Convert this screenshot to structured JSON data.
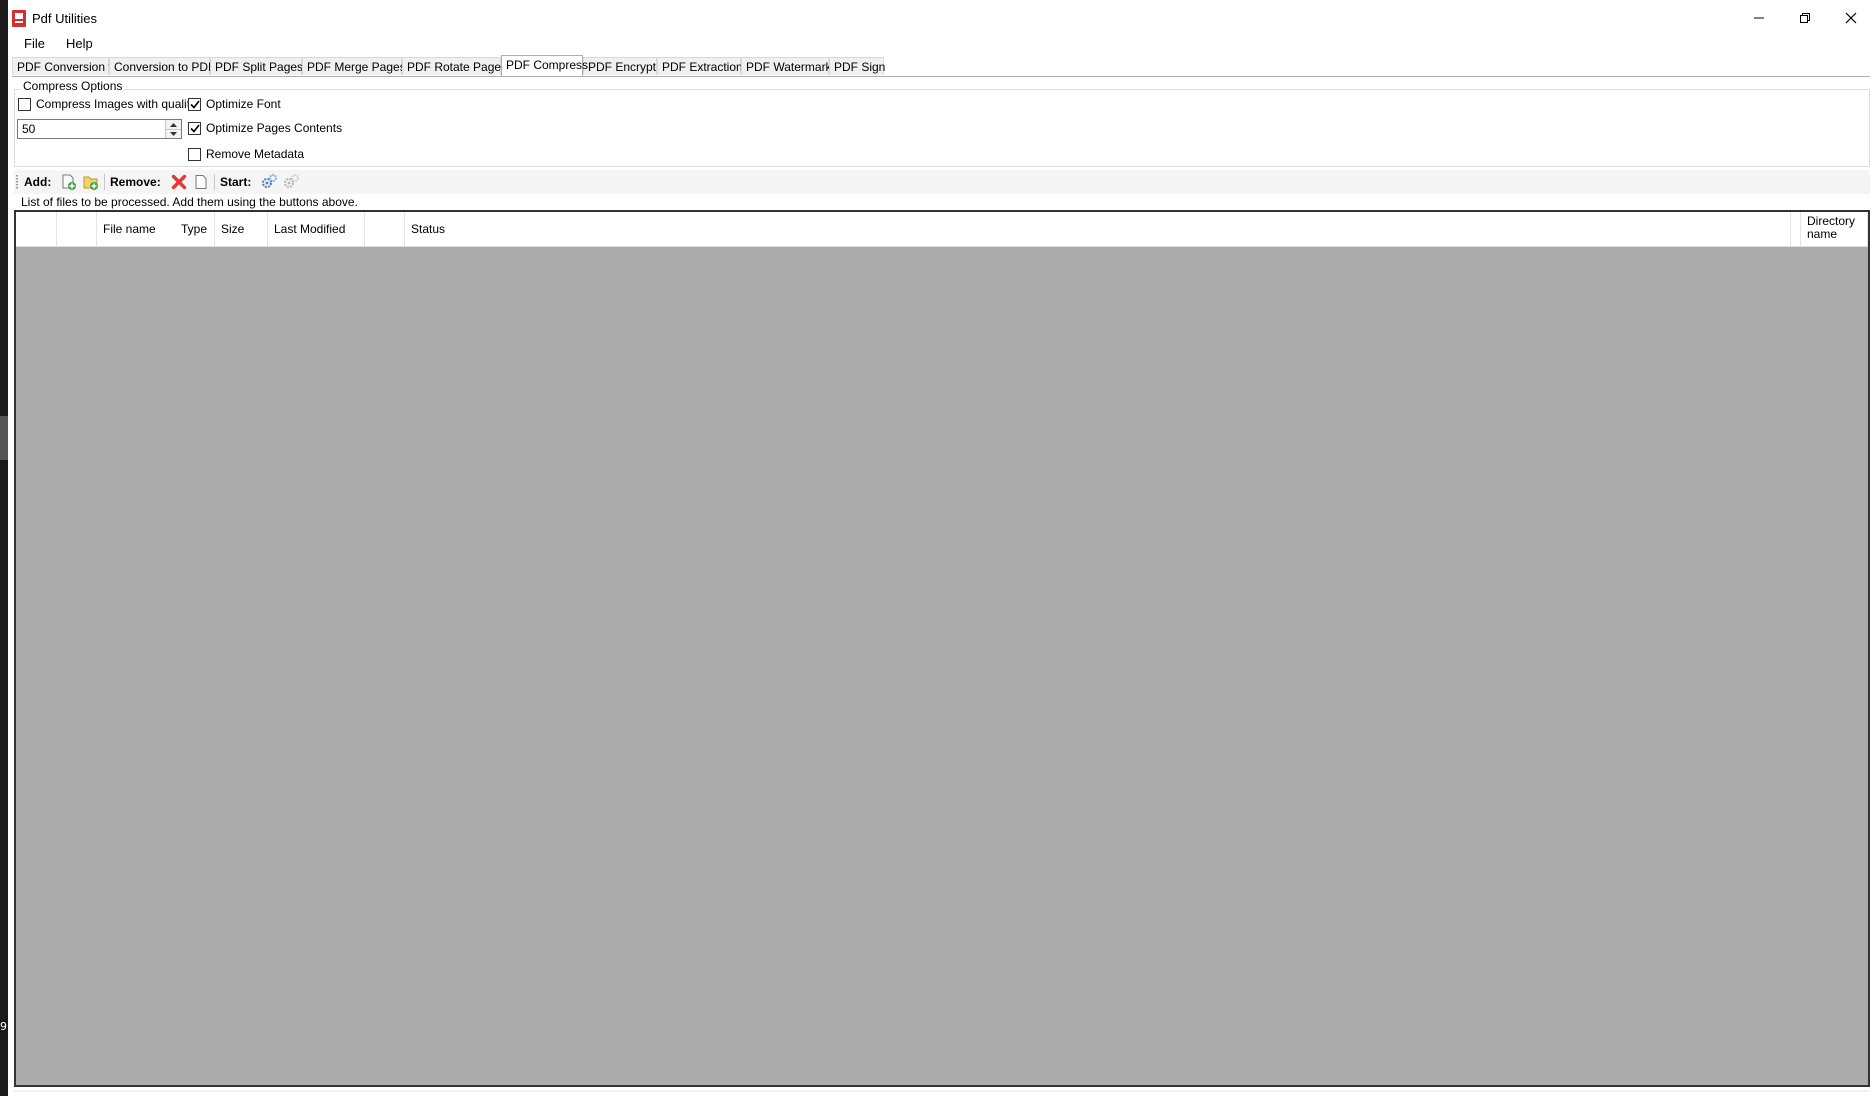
{
  "window": {
    "title": "Pdf Utilities",
    "controls": {
      "minimize": "minimize-icon",
      "restore": "restore-icon",
      "close": "close-icon"
    }
  },
  "left_strip": {
    "digit": "9"
  },
  "menu": {
    "items": [
      "File",
      "Help"
    ]
  },
  "tabs": [
    "PDF Conversion to",
    "Conversion to PDF",
    "PDF Split Pages",
    "PDF Merge Pages",
    "PDF Rotate Pages",
    "PDF Compress",
    "PDF Encrypt",
    "PDF Extraction",
    "PDF Watermark",
    "PDF Sign"
  ],
  "active_tab": "PDF Compress",
  "compress_options": {
    "title": "Compress Options",
    "compress_images": {
      "label": "Compress Images with quality",
      "checked": false
    },
    "quality_value": "50",
    "optimize_font": {
      "label": "Optimize Font",
      "checked": true
    },
    "optimize_pages": {
      "label": "Optimize Pages Contents",
      "checked": true
    },
    "remove_metadata": {
      "label": "Remove Metadata",
      "checked": false
    }
  },
  "toolbar": {
    "add_label": "Add:",
    "remove_label": "Remove:",
    "start_label": "Start:"
  },
  "hint": "List of files to be processed. Add  them using the buttons above.",
  "file_list": {
    "columns": [
      "",
      "",
      "File name",
      "Type",
      "Size",
      "Last Modified",
      "",
      "Status",
      "",
      "Directory name"
    ],
    "rows": []
  },
  "colors": {
    "list_background": "#ababab",
    "remove_icon": "#e53935",
    "add_icon": "#43a047",
    "app_icon": "#d32f2f"
  }
}
